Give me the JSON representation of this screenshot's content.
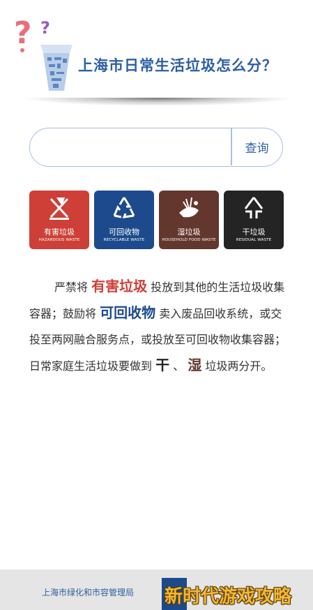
{
  "header": {
    "title": "上海市日常生活垃圾怎么分？"
  },
  "search": {
    "placeholder": "",
    "value": "",
    "button_label": "查询"
  },
  "categories": [
    {
      "label_cn": "有害垃圾",
      "label_en": "HAZARDOUS WASTE",
      "color": "#cd3f37",
      "icon": "hazardous-icon"
    },
    {
      "label_cn": "可回收物",
      "label_en": "RECYCLABLE WASTE",
      "color": "#1d4a8c",
      "icon": "recycle-icon"
    },
    {
      "label_cn": "湿垃圾",
      "label_en": "HOUSEHOLD FOOD WASTE",
      "color": "#63372d",
      "icon": "food-waste-icon"
    },
    {
      "label_cn": "干垃圾",
      "label_en": "RESIDUAL WASTE",
      "color": "#242424",
      "icon": "residual-icon"
    }
  ],
  "description": {
    "p1": "严禁将",
    "hazard": "有害垃圾",
    "p2": "投放到其他的生活垃圾收集容器；鼓励将",
    "recyc": "可回收物",
    "p3": "卖入废品回收系统，或交投至两网融合服务点，或投放至可回收物收集容器；日常家庭生活垃圾要做到",
    "dry": "干",
    "sep": "、",
    "wet": "湿",
    "p4": "垃圾两分开。"
  },
  "footer": {
    "org": "上海市绿化和市容管理局"
  },
  "watermark": "新时代游戏攻略"
}
